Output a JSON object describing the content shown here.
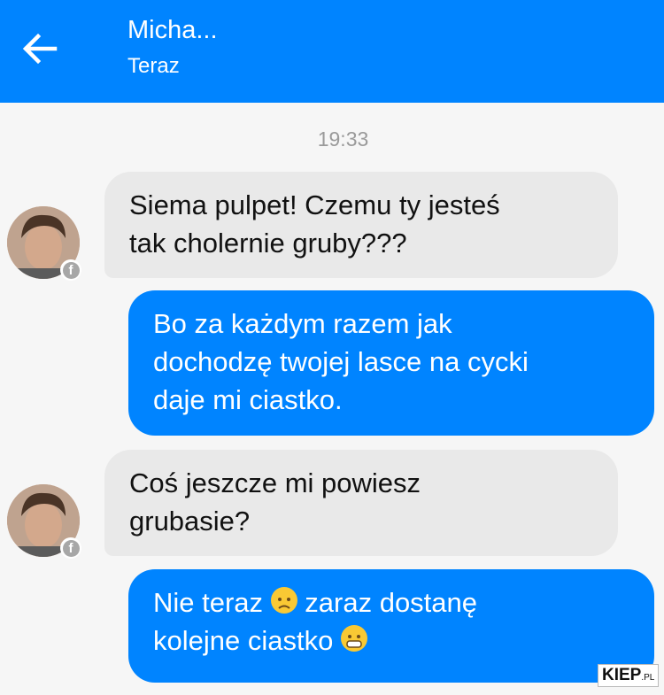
{
  "header": {
    "title": "Micha...",
    "subtitle": "Teraz",
    "back_icon": "arrow-left-icon",
    "background": "#0084ff"
  },
  "conversation": {
    "timestamp": "19:33",
    "messages": [
      {
        "direction": "incoming",
        "text": "Siema pulpet! Czemu ty jesteś\ntak cholernie gruby???"
      },
      {
        "direction": "outgoing",
        "text": "Bo za każdym razem jak\ndochodzę twojej lasce na cycki\ndaje mi ciastko."
      },
      {
        "direction": "incoming",
        "text": "Coś jeszcze mi powiesz\ngrubasie?"
      },
      {
        "direction": "outgoing",
        "text_before_emoji": "Nie teraz ",
        "emoji_1": "disappointed-face-emoji",
        "text_after_emoji": " zaraz dostanę\nkolejne ciastko ",
        "emoji_2": "grinning-face-emoji"
      }
    ]
  },
  "watermark": {
    "main": "KIEP",
    "suffix": ".PL"
  },
  "colors": {
    "incoming_bubble": "#e9e9e9",
    "outgoing_bubble": "#0084ff"
  }
}
